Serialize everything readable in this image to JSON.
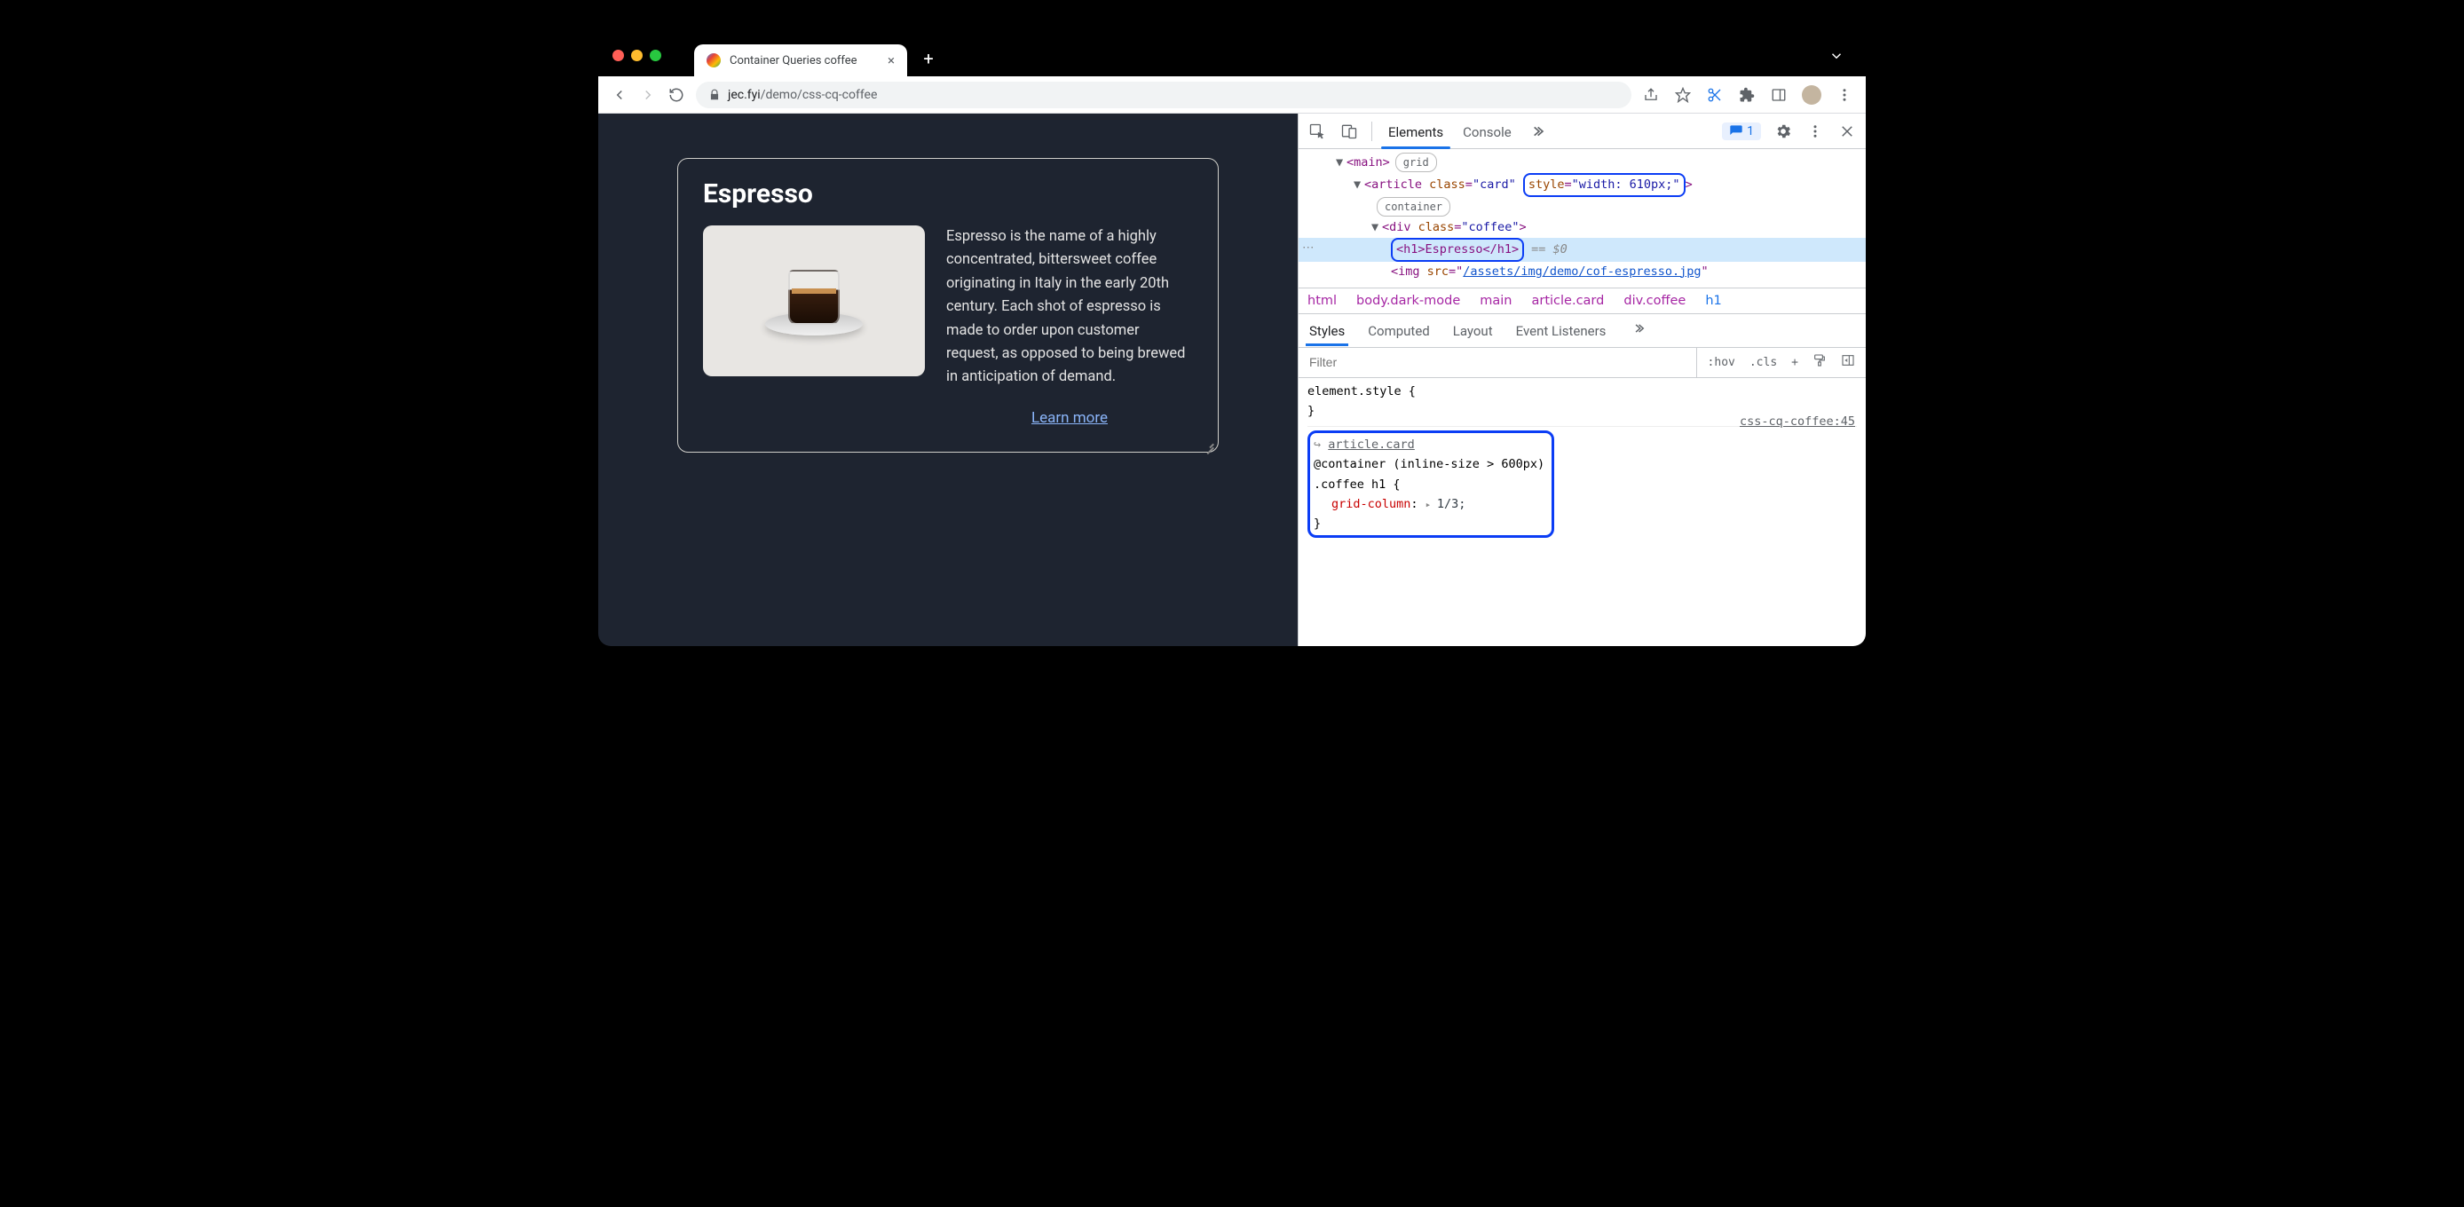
{
  "browser": {
    "tab_title": "Container Queries coffee",
    "url_host": "jec.fyi",
    "url_path": "/demo/css-cq-coffee"
  },
  "page": {
    "heading": "Espresso",
    "description": "Espresso is the name of a highly concentrated, bittersweet coffee originating in Italy in the early 20th century. Each shot of espresso is made to order upon customer request, as opposed to being brewed in anticipation of demand.",
    "learn_more": "Learn more"
  },
  "devtools": {
    "tabs": {
      "elements": "Elements",
      "console": "Console"
    },
    "badge_count": "1",
    "dom": {
      "main_open": "<main>",
      "main_badge": "grid",
      "article_open_a": "<article ",
      "article_class_attr": "class",
      "article_class_val": "\"card\"",
      "article_style_attr": "style",
      "article_style_val": "\"width: 610px;\"",
      "article_close": ">",
      "article_badge": "container",
      "div_open": "<div ",
      "div_class_attr": "class",
      "div_class_val": "\"coffee\"",
      "div_close": ">",
      "h1_full": "<h1>Espresso</h1>",
      "h1_after": "== $0",
      "img_open": "<img ",
      "img_src_attr": "src",
      "img_src_val": "/assets/img/demo/cof-espresso.jpg",
      "img_close": "\""
    },
    "breadcrumb": {
      "b1": "html",
      "b2": "body.dark-mode",
      "b3": "main",
      "b4": "article.card",
      "b5": "div.coffee",
      "b6": "h1"
    },
    "styles_tabs": {
      "styles": "Styles",
      "computed": "Computed",
      "layout": "Layout",
      "listeners": "Event Listeners"
    },
    "filter_placeholder": "Filter",
    "filter_tools": {
      "hov": ":hov",
      "cls": ".cls",
      "plus": "+"
    },
    "rules": {
      "element_style": "element.style {",
      "element_style_close": "}",
      "container_ref": "article.card",
      "container_query": "@container (inline-size > 600px)",
      "selector": ".coffee h1 {",
      "prop": "grid-column",
      "val": "1/3;",
      "close": "}",
      "source": "css-cq-coffee:45"
    }
  }
}
